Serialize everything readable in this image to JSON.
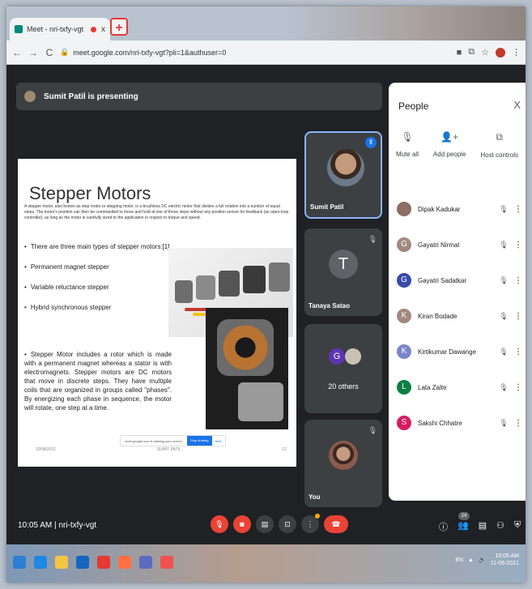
{
  "browser": {
    "tab_title": "Meet - nri-txfy-vgt",
    "tab_close": "x",
    "new_tab": "+",
    "url": "meet.google.com/nri-txfy-vgt?pli=1&authuser=0"
  },
  "meet": {
    "presenting_text": "Sumit Patil is presenting",
    "meeting_time": "10:05 AM",
    "meeting_code": "nri-txfy-vgt",
    "participant_count": "24"
  },
  "slide": {
    "title": "Stepper Motors",
    "definition": "A stepper motor, also known as step motor or stepping motor, is a brushless DC electric motor that divides a full rotation into a number of equal steps. The motor's position can then be commanded to move and hold at one of these steps without any position sensor for feedback (an open-loop controller), as long as the motor is carefully sized to the application in respect to torque and speed.",
    "types": [
      "There are three main types of stepper motors:[1]",
      "Permanent magnet stepper",
      "Variable reluctance stepper",
      "Hybrid synchronous stepper"
    ],
    "paragraph": "Stepper Motor includes a rotor which is made with a permanent magnet whereas a stator is with electromagnets. Stepper motors are DC motors that move in discrete steps. They have multiple coils that are organized in groups called \"phases\". By energizing each phase in sequence, the motor will rotate, one step at a time.",
    "notice_text": "meet.google.com is sharing your screen.",
    "notice_stop": "Stop sharing",
    "notice_hide": "Hide",
    "footer_left": "10/08/2021",
    "footer_center": "SUMIT PATIL",
    "footer_right": "12"
  },
  "tiles": {
    "presenter": "Sumit Patil",
    "tile2_name": "Tanaya Satao",
    "tile2_initial": "T",
    "others_initial": "G",
    "others_label": "20 others",
    "self_label": "You"
  },
  "people": {
    "title": "People",
    "close": "X",
    "mute_all": "Mute all",
    "add_people": "Add people",
    "host_controls": "Host controls",
    "participants": [
      {
        "name": "Dipak Kadukar",
        "initial": "",
        "color": "#8d6e63"
      },
      {
        "name": "Gayatri Nirmal",
        "initial": "G",
        "color": "#a1887f"
      },
      {
        "name": "Gayatri Sadatkar",
        "initial": "G",
        "color": "#3949ab"
      },
      {
        "name": "Kiran Bodade",
        "initial": "K",
        "color": "#a1887f"
      },
      {
        "name": "Kirtikumar Dawange",
        "initial": "K",
        "color": "#7986cb"
      },
      {
        "name": "Lata Zalte",
        "initial": "L",
        "color": "#0b8043"
      },
      {
        "name": "Sakshi Chhatre",
        "initial": "S",
        "color": "#d81b60"
      }
    ]
  },
  "taskbar": {
    "lang": "EN",
    "time": "10:05 AM",
    "date": "11-06-2021"
  }
}
